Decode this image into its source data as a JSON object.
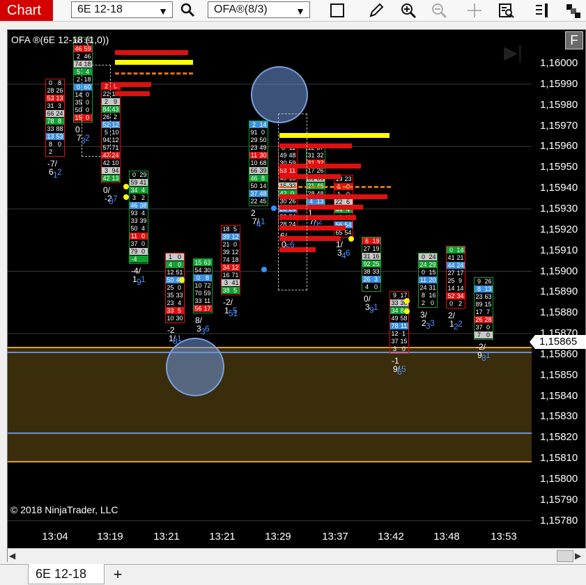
{
  "toolbar": {
    "chart_tab": "Chart",
    "instrument": "6E 12-18",
    "indicator": "OFA®(8/3)",
    "icons": [
      "search-icon",
      "square-icon",
      "pencil-icon",
      "zoom-in-icon",
      "zoom-out-icon",
      "crosshair-icon",
      "data-box-icon",
      "properties-icon",
      "arrange-icon"
    ]
  },
  "chart": {
    "title": "OFA ®(6E 12-18 (1,0))",
    "copyright": "© 2018 NinjaTrader, LLC",
    "f_button": "F",
    "current_price": "1,15865",
    "price_labels": [
      "1,16000",
      "1,15990",
      "1,15980",
      "1,15970",
      "1,15960",
      "1,15950",
      "1,15940",
      "1,15930",
      "1,15920",
      "1,15910",
      "1,15900",
      "1,15890",
      "1,15880",
      "1,15870",
      "1,15860",
      "1,15850",
      "1,15840",
      "1,15830",
      "1,15820",
      "1,15810",
      "1,15800",
      "1,15790",
      "1,15780"
    ],
    "time_labels": [
      "13:04",
      "13:19",
      "13:21",
      "13:21",
      "13:29",
      "13:37",
      "13:42",
      "13:48",
      "13:53"
    ],
    "colors": {
      "background": "#000000",
      "band": "#3a2d0c",
      "band_border": "#e0a020",
      "blue_line": "#6e8fd0",
      "bid_red": "#e01010",
      "ask_green": "#10a030",
      "poc_yellow": "#ffff00"
    }
  },
  "bars": [
    {
      "delta_top": "-7/",
      "delta_vals": [
        "6",
        "1",
        "2"
      ],
      "rows": [
        [
          "0",
          "8"
        ],
        [
          "28",
          "26"
        ],
        [
          "53",
          "13"
        ],
        [
          "31",
          "3"
        ],
        [
          "66",
          "24"
        ],
        [
          "78",
          "8"
        ],
        [
          "33",
          "88"
        ],
        [
          "13",
          "53"
        ],
        [
          "8",
          "0"
        ],
        [
          "2",
          ""
        ]
      ]
    },
    {
      "delta_top": "0",
      "delta_vals": [
        "7",
        "3",
        "2"
      ],
      "rows": [
        [
          "60",
          "35"
        ],
        [
          "46",
          "59"
        ],
        [
          "2",
          "46"
        ],
        [
          "74",
          "18"
        ],
        [
          "5",
          "4"
        ],
        [
          "2",
          "18"
        ],
        [
          "0",
          "60"
        ],
        [
          "14",
          "0"
        ],
        [
          "35",
          "0"
        ],
        [
          "50",
          "0"
        ],
        [
          "15",
          "0"
        ]
      ]
    },
    {
      "delta_top": "0/",
      "delta_vals": [
        "-2",
        "0",
        "7"
      ],
      "rows": [
        [
          "2",
          "9"
        ],
        [
          "22",
          "10"
        ],
        [
          "2",
          "9"
        ],
        [
          "84",
          "43"
        ],
        [
          "26",
          "2"
        ],
        [
          "52",
          "12"
        ],
        [
          "5",
          "10"
        ],
        [
          "94",
          "12"
        ],
        [
          "57",
          "71"
        ],
        [
          "47",
          "24"
        ],
        [
          "42",
          "10"
        ],
        [
          "3",
          "94"
        ],
        [
          "42",
          "13"
        ]
      ]
    },
    {
      "delta_top": "-4/",
      "delta_vals": [
        "1",
        "9",
        "1"
      ],
      "rows": [
        [
          "0",
          "29"
        ],
        [
          "59",
          "41"
        ],
        [
          "34",
          "4"
        ],
        [
          "3",
          "2"
        ],
        [
          "46",
          "38"
        ],
        [
          "93",
          "4"
        ],
        [
          "33",
          "39"
        ],
        [
          "50",
          "4"
        ],
        [
          "11",
          "0"
        ],
        [
          "37",
          "0"
        ],
        [
          "79",
          "0"
        ],
        [
          "-4",
          ""
        ]
      ]
    },
    {
      "delta_top": "-2",
      "delta_vals": [
        "1/",
        "8",
        "1"
      ],
      "rows": [
        [
          "1",
          "0"
        ],
        [
          "4",
          "0"
        ],
        [
          "12",
          "51"
        ],
        [
          "50",
          "49"
        ],
        [
          "25",
          "0"
        ],
        [
          "35",
          "33"
        ],
        [
          "23",
          "4"
        ],
        [
          "33",
          "5"
        ],
        [
          "10",
          "30"
        ]
      ]
    },
    {
      "delta_top": "8/",
      "delta_vals": [
        "3",
        "3",
        "6"
      ],
      "rows": [
        [
          "15",
          "63"
        ],
        [
          "54",
          "30"
        ],
        [
          "0",
          "8"
        ],
        [
          "10",
          "72"
        ],
        [
          "70",
          "59"
        ],
        [
          "33",
          "11"
        ],
        [
          "56",
          "17"
        ]
      ]
    },
    {
      "delta_top": "-2/",
      "delta_vals": [
        "1",
        "51",
        "5"
      ],
      "rows": [
        [
          "18",
          "5"
        ],
        [
          "39",
          "12"
        ],
        [
          "21",
          "0"
        ],
        [
          "39",
          "12"
        ],
        [
          "74",
          "18"
        ],
        [
          "34",
          "12"
        ],
        [
          "16",
          "71"
        ],
        [
          "3",
          "41"
        ],
        [
          "38",
          "5"
        ]
      ]
    },
    {
      "delta_top": "2",
      "delta_vals": [
        "7/",
        "4",
        "1"
      ],
      "rows": [
        [
          "2",
          "14"
        ],
        [
          "91",
          "0"
        ],
        [
          "29",
          "50"
        ],
        [
          "23",
          "49"
        ],
        [
          "11",
          "30"
        ],
        [
          "10",
          "68"
        ],
        [
          "66",
          "39"
        ],
        [
          "46",
          "8"
        ],
        [
          "50",
          "14"
        ],
        [
          "37",
          "48"
        ],
        [
          "22",
          "45"
        ]
      ]
    },
    {
      "delta_top": "6/",
      "delta_vals": [
        "0",
        "5",
        "6"
      ],
      "rows": [
        [
          "8",
          "11"
        ],
        [
          "49",
          "48"
        ],
        [
          "30",
          "59"
        ],
        [
          "53",
          "11"
        ],
        [
          "40",
          "13"
        ],
        [
          "15",
          "32"
        ],
        [
          "42",
          "0"
        ],
        [
          "30",
          "26"
        ],
        [
          "28",
          "24"
        ],
        [
          "22",
          "24"
        ],
        [
          "28",
          "24"
        ]
      ]
    },
    {
      "delta_top": "1",
      "delta_vals": [
        "7/",
        "0",
        "2"
      ],
      "rows": [
        [
          "12",
          "37"
        ],
        [
          "31",
          "32"
        ],
        [
          "31",
          "32"
        ],
        [
          "17",
          "26"
        ],
        [
          "31",
          "31"
        ],
        [
          "21",
          "46"
        ],
        [
          "28",
          "48"
        ],
        [
          "4",
          "13"
        ]
      ]
    },
    {
      "delta_top": "1/",
      "delta_vals": [
        "3",
        "4",
        "6"
      ],
      "rows": [
        [
          "19",
          "23"
        ],
        [
          "1",
          "0"
        ],
        [
          "1",
          "0"
        ],
        [
          "22",
          "6"
        ],
        [
          "44",
          "4"
        ],
        [
          "43",
          "19"
        ],
        [
          "56",
          "54"
        ],
        [
          "65",
          "54"
        ]
      ]
    },
    {
      "delta_top": "0/",
      "delta_vals": [
        "3",
        "9",
        "1"
      ],
      "rows": [
        [
          "6",
          "19"
        ],
        [
          "27",
          "19"
        ],
        [
          "31",
          "16"
        ],
        [
          "92",
          "25"
        ],
        [
          "38",
          "33"
        ],
        [
          "26",
          "3"
        ],
        [
          "4",
          "0"
        ]
      ]
    },
    {
      "delta_top": "-1",
      "delta_vals": [
        "9/",
        "6",
        "5"
      ],
      "rows": [
        [
          "9",
          "17"
        ],
        [
          "33",
          "30"
        ],
        [
          "34",
          "84"
        ],
        [
          "49",
          "58"
        ],
        [
          "78",
          "11"
        ],
        [
          "12",
          "1"
        ],
        [
          "37",
          "15"
        ],
        [
          "3",
          "0"
        ]
      ]
    },
    {
      "delta_top": "3/",
      "delta_vals": [
        "2",
        "3",
        "3"
      ],
      "rows": [
        [
          "0",
          "24"
        ],
        [
          "24",
          "29"
        ],
        [
          "0",
          "15"
        ],
        [
          "11",
          "20"
        ],
        [
          "24",
          "31"
        ],
        [
          "8",
          "16"
        ],
        [
          "2",
          "0"
        ]
      ]
    },
    {
      "delta_top": "2/",
      "delta_vals": [
        "1",
        "2",
        "2"
      ],
      "rows": [
        [
          "0",
          "14"
        ],
        [
          "41",
          "21"
        ],
        [
          "44",
          "24"
        ],
        [
          "27",
          "17"
        ],
        [
          "25",
          "9"
        ],
        [
          "14",
          "14"
        ],
        [
          "52",
          "34"
        ],
        [
          "0",
          "2"
        ]
      ]
    },
    {
      "delta_top": "-2/",
      "delta_vals": [
        "9",
        "8",
        "1"
      ],
      "rows": [
        [
          "9",
          "26"
        ],
        [
          "8",
          "13"
        ],
        [
          "23",
          "63"
        ],
        [
          "89",
          "15"
        ],
        [
          "17",
          "7"
        ],
        [
          "26",
          "28"
        ],
        [
          "37",
          "0"
        ],
        [
          "7",
          "0"
        ]
      ]
    }
  ]
}
